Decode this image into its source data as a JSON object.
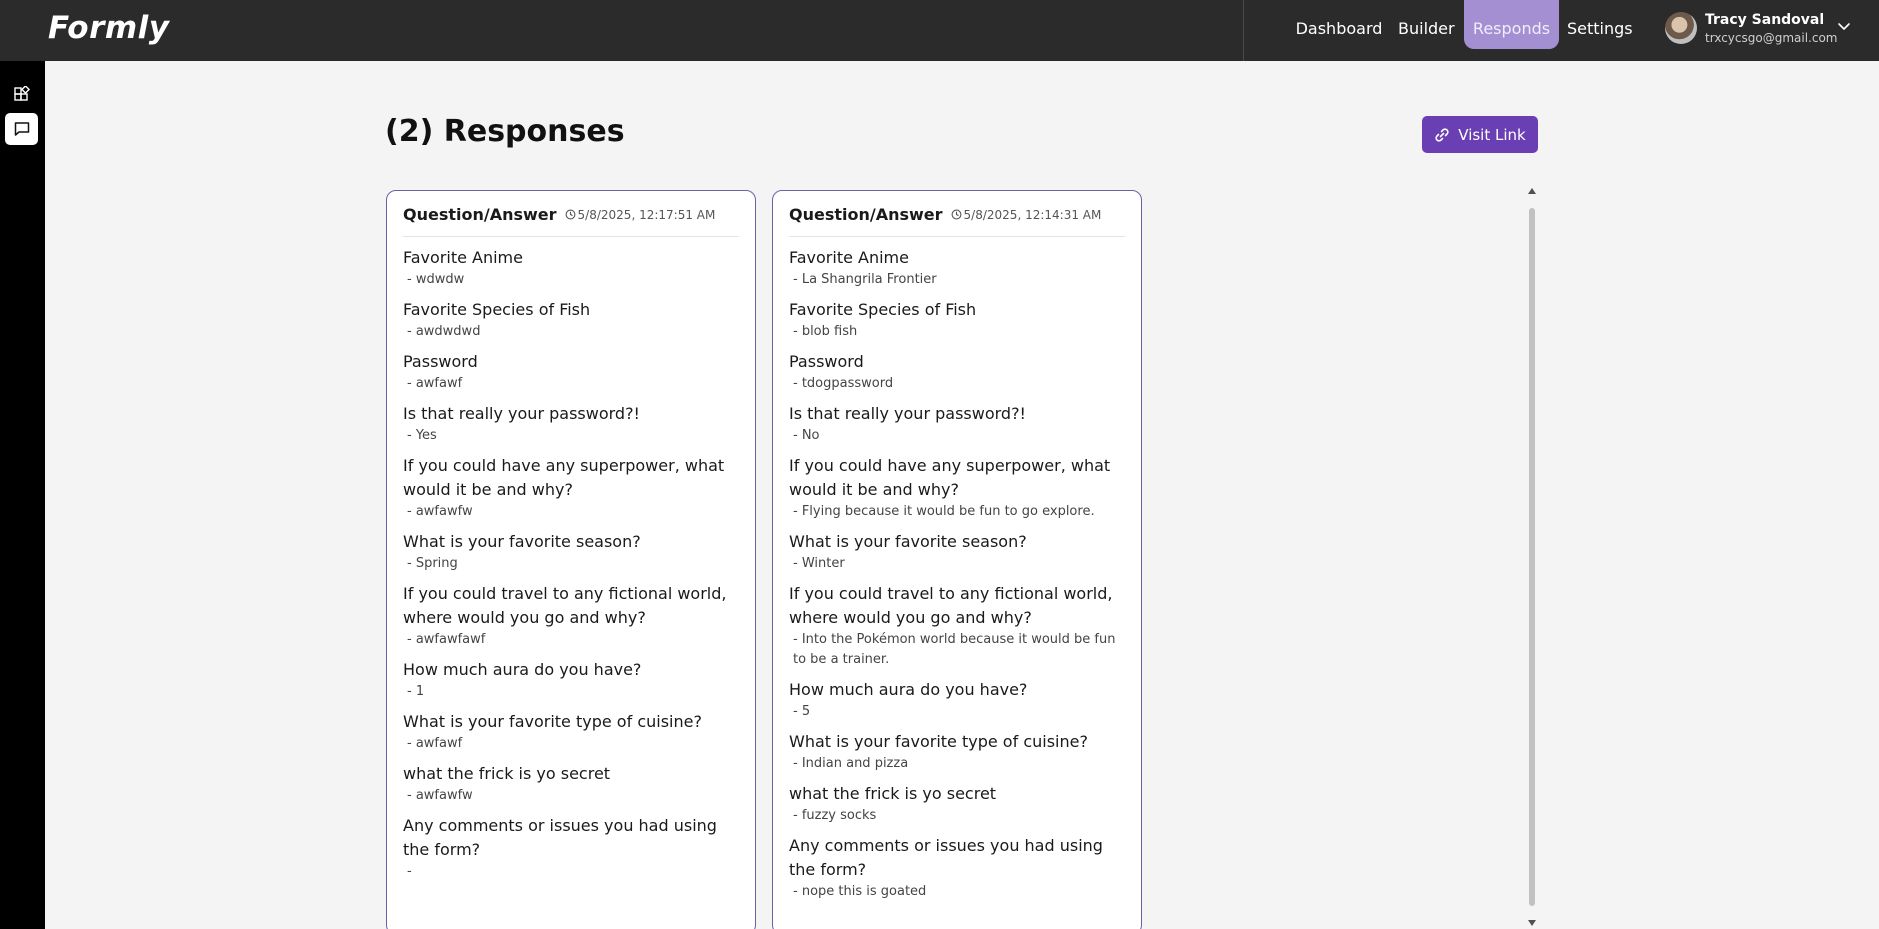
{
  "app": {
    "logo": "Formly"
  },
  "nav": {
    "items": [
      {
        "label": "Dashboard"
      },
      {
        "label": "Builder"
      },
      {
        "label": "Responds"
      },
      {
        "label": "Settings"
      }
    ],
    "active": "Responds",
    "active_color": "#a58fd3"
  },
  "user": {
    "name": "Tracy Sandoval",
    "email": "trxcycsgo@gmail.com"
  },
  "sidebar": {
    "items": [
      {
        "icon": "layout-icon"
      },
      {
        "icon": "message-square-icon"
      }
    ]
  },
  "page": {
    "title": "(2) Responses",
    "visit_link_label": "Visit Link",
    "accent": "#6a3fb3"
  },
  "responses": [
    {
      "header": "Question/Answer",
      "timestamp": "5/8/2025, 12:17:51 AM",
      "items": [
        {
          "q": "Favorite Anime",
          "a": "- wdwdw"
        },
        {
          "q": "Favorite Species of Fish",
          "a": "- awdwdwd"
        },
        {
          "q": "Password",
          "a": "- awfawf"
        },
        {
          "q": "Is that really your password?!",
          "a": "- Yes"
        },
        {
          "q": "If you could have any superpower, what would it be and why?",
          "a": "- awfawfw"
        },
        {
          "q": "What is your favorite season?",
          "a": "- Spring"
        },
        {
          "q": "If you could travel to any fictional world, where would you go and why?",
          "a": "- awfawfawf"
        },
        {
          "q": "How much aura do you have?",
          "a": "- 1"
        },
        {
          "q": "What is your favorite type of cuisine?",
          "a": "- awfawf"
        },
        {
          "q": "what the frick is yo secret",
          "a": "- awfawfw"
        },
        {
          "q": "Any comments or issues you had using the form?",
          "a": "-"
        }
      ]
    },
    {
      "header": "Question/Answer",
      "timestamp": "5/8/2025, 12:14:31 AM",
      "items": [
        {
          "q": "Favorite Anime",
          "a": "- La Shangrila Frontier"
        },
        {
          "q": "Favorite Species of Fish",
          "a": "- blob fish"
        },
        {
          "q": "Password",
          "a": "- tdogpassword"
        },
        {
          "q": "Is that really your password?!",
          "a": "- No"
        },
        {
          "q": "If you could have any superpower, what would it be and why?",
          "a": "- Flying because it would be fun to go explore."
        },
        {
          "q": "What is your favorite season?",
          "a": "- Winter"
        },
        {
          "q": "If you could travel to any fictional world, where would you go and why?",
          "a": "- Into the Pokémon world because it would be fun to be a trainer."
        },
        {
          "q": "How much aura do you have?",
          "a": "- 5"
        },
        {
          "q": "What is your favorite type of cuisine?",
          "a": "- Indian and pizza"
        },
        {
          "q": "what the frick is yo secret",
          "a": "- fuzzy socks"
        },
        {
          "q": "Any comments or issues you had using the form?",
          "a": "- nope this is goated"
        }
      ]
    }
  ]
}
